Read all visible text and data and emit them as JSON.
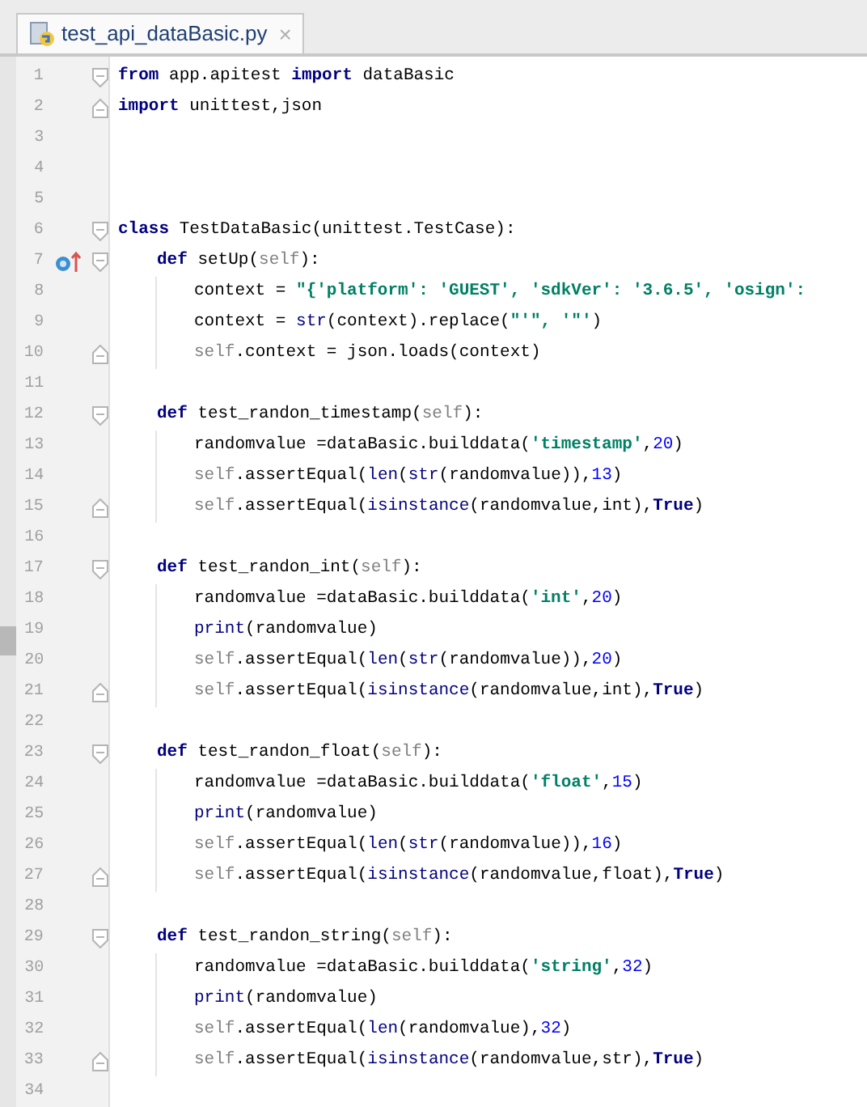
{
  "tab": {
    "title": "test_api_dataBasic.py",
    "close": "×"
  },
  "lines": [
    {
      "number": "1",
      "kind": "fold-start",
      "overridden": false,
      "tokens": [
        {
          "kind": "keyword",
          "text": "from"
        },
        {
          "kind": "plain",
          "text": " app.apitest "
        },
        {
          "kind": "keyword",
          "text": "import"
        },
        {
          "kind": "plain",
          "text": " dataBasic"
        }
      ]
    },
    {
      "number": "2",
      "kind": "fold-end",
      "overridden": false,
      "tokens": [
        {
          "kind": "keyword",
          "text": "import"
        },
        {
          "kind": "plain",
          "text": " unittest,json"
        }
      ]
    },
    {
      "number": "3",
      "kind": "line",
      "overridden": false
    },
    {
      "number": "4",
      "kind": "line",
      "overridden": false
    },
    {
      "number": "5",
      "kind": "line",
      "overridden": false
    },
    {
      "number": "6",
      "kind": "fold-start",
      "overridden": false,
      "tokens": [
        {
          "kind": "keyword",
          "text": "class"
        },
        {
          "kind": "plain",
          "text": " TestDataBasic(unittest.TestCase):"
        }
      ],
      "children": [
        {
          "number": "7",
          "kind": "fold-start",
          "overridden": true,
          "tokens": [
            {
              "kind": "keyword",
              "text": "def"
            },
            {
              "kind": "plain",
              "text": " setUp("
            },
            {
              "kind": "self",
              "text": "self"
            },
            {
              "kind": "plain",
              "text": "):"
            }
          ],
          "children": [
            {
              "number": "8",
              "kind": "line",
              "overridden": false,
              "tokens": [
                {
                  "kind": "plain",
                  "text": "context = "
                },
                {
                  "kind": "string",
                  "text": "\"{'platform': 'GUEST', 'sdkVer': '3.6.5', 'osign':"
                }
              ]
            },
            {
              "number": "9",
              "kind": "line",
              "overridden": false,
              "tokens": [
                {
                  "kind": "plain",
                  "text": "context = "
                },
                {
                  "kind": "builtin",
                  "text": "str"
                },
                {
                  "kind": "plain",
                  "text": "(context).replace("
                },
                {
                  "kind": "string",
                  "text": "\"'\", '\"'"
                },
                {
                  "kind": "plain",
                  "text": ")"
                }
              ]
            },
            {
              "number": "10",
              "kind": "fold-end",
              "overridden": false,
              "tokens": [
                {
                  "kind": "self",
                  "text": "self"
                },
                {
                  "kind": "plain",
                  "text": ".context = json.loads(context)"
                }
              ]
            }
          ]
        },
        {
          "number": "11",
          "kind": "line",
          "overridden": false
        },
        {
          "number": "12",
          "kind": "fold-start",
          "overridden": false,
          "tokens": [
            {
              "kind": "keyword",
              "text": "def"
            },
            {
              "kind": "plain",
              "text": " test_randon_timestamp("
            },
            {
              "kind": "self",
              "text": "self"
            },
            {
              "kind": "plain",
              "text": "):"
            }
          ],
          "children": [
            {
              "number": "13",
              "kind": "line",
              "overridden": false,
              "tokens": [
                {
                  "kind": "plain",
                  "text": "randomvalue =dataBasic.builddata("
                },
                {
                  "kind": "string",
                  "text": "'timestamp'"
                },
                {
                  "kind": "plain",
                  "text": ","
                },
                {
                  "kind": "number",
                  "text": "20"
                },
                {
                  "kind": "plain",
                  "text": ")"
                }
              ]
            },
            {
              "number": "14",
              "kind": "line",
              "overridden": false,
              "tokens": [
                {
                  "kind": "self",
                  "text": "self"
                },
                {
                  "kind": "plain",
                  "text": ".assertEqual("
                },
                {
                  "kind": "builtin",
                  "text": "len"
                },
                {
                  "kind": "plain",
                  "text": "("
                },
                {
                  "kind": "builtin",
                  "text": "str"
                },
                {
                  "kind": "plain",
                  "text": "(randomvalue)),"
                },
                {
                  "kind": "number",
                  "text": "13"
                },
                {
                  "kind": "plain",
                  "text": ")"
                }
              ]
            },
            {
              "number": "15",
              "kind": "fold-end",
              "overridden": false,
              "tokens": [
                {
                  "kind": "self",
                  "text": "self"
                },
                {
                  "kind": "plain",
                  "text": ".assertEqual("
                },
                {
                  "kind": "builtin",
                  "text": "isinstance"
                },
                {
                  "kind": "plain",
                  "text": "(randomvalue,int),"
                },
                {
                  "kind": "keyword",
                  "text": "True"
                },
                {
                  "kind": "plain",
                  "text": ")"
                }
              ]
            }
          ]
        },
        {
          "number": "16",
          "kind": "line",
          "overridden": false
        },
        {
          "number": "17",
          "kind": "fold-start",
          "overridden": false,
          "tokens": [
            {
              "kind": "keyword",
              "text": "def"
            },
            {
              "kind": "plain",
              "text": " test_randon_int("
            },
            {
              "kind": "self",
              "text": "self"
            },
            {
              "kind": "plain",
              "text": "):"
            }
          ],
          "children": [
            {
              "number": "18",
              "kind": "line",
              "overridden": false,
              "tokens": [
                {
                  "kind": "plain",
                  "text": "randomvalue =dataBasic.builddata("
                },
                {
                  "kind": "string",
                  "text": "'int'"
                },
                {
                  "kind": "plain",
                  "text": ","
                },
                {
                  "kind": "number",
                  "text": "20"
                },
                {
                  "kind": "plain",
                  "text": ")"
                }
              ]
            },
            {
              "number": "19",
              "kind": "line",
              "overridden": false,
              "tokens": [
                {
                  "kind": "builtin",
                  "text": "print"
                },
                {
                  "kind": "plain",
                  "text": "(randomvalue)"
                }
              ]
            },
            {
              "number": "20",
              "kind": "line",
              "overridden": false,
              "tokens": [
                {
                  "kind": "self",
                  "text": "self"
                },
                {
                  "kind": "plain",
                  "text": ".assertEqual("
                },
                {
                  "kind": "builtin",
                  "text": "len"
                },
                {
                  "kind": "plain",
                  "text": "("
                },
                {
                  "kind": "builtin",
                  "text": "str"
                },
                {
                  "kind": "plain",
                  "text": "(randomvalue)),"
                },
                {
                  "kind": "number",
                  "text": "20"
                },
                {
                  "kind": "plain",
                  "text": ")"
                }
              ]
            },
            {
              "number": "21",
              "kind": "fold-end",
              "overridden": false,
              "tokens": [
                {
                  "kind": "self",
                  "text": "self"
                },
                {
                  "kind": "plain",
                  "text": ".assertEqual("
                },
                {
                  "kind": "builtin",
                  "text": "isinstance"
                },
                {
                  "kind": "plain",
                  "text": "(randomvalue,int),"
                },
                {
                  "kind": "keyword",
                  "text": "True"
                },
                {
                  "kind": "plain",
                  "text": ")"
                }
              ]
            }
          ]
        },
        {
          "number": "22",
          "kind": "line",
          "overridden": false
        },
        {
          "number": "23",
          "kind": "fold-start",
          "overridden": false,
          "tokens": [
            {
              "kind": "keyword",
              "text": "def"
            },
            {
              "kind": "plain",
              "text": " test_randon_float("
            },
            {
              "kind": "self",
              "text": "self"
            },
            {
              "kind": "plain",
              "text": "):"
            }
          ],
          "children": [
            {
              "number": "24",
              "kind": "line",
              "overridden": false,
              "tokens": [
                {
                  "kind": "plain",
                  "text": "randomvalue =dataBasic.builddata("
                },
                {
                  "kind": "string",
                  "text": "'float'"
                },
                {
                  "kind": "plain",
                  "text": ","
                },
                {
                  "kind": "number",
                  "text": "15"
                },
                {
                  "kind": "plain",
                  "text": ")"
                }
              ]
            },
            {
              "number": "25",
              "kind": "line",
              "overridden": false,
              "tokens": [
                {
                  "kind": "builtin",
                  "text": "print"
                },
                {
                  "kind": "plain",
                  "text": "(randomvalue)"
                }
              ]
            },
            {
              "number": "26",
              "kind": "line",
              "overridden": false,
              "tokens": [
                {
                  "kind": "self",
                  "text": "self"
                },
                {
                  "kind": "plain",
                  "text": ".assertEqual("
                },
                {
                  "kind": "builtin",
                  "text": "len"
                },
                {
                  "kind": "plain",
                  "text": "("
                },
                {
                  "kind": "builtin",
                  "text": "str"
                },
                {
                  "kind": "plain",
                  "text": "(randomvalue)),"
                },
                {
                  "kind": "number",
                  "text": "16"
                },
                {
                  "kind": "plain",
                  "text": ")"
                }
              ]
            },
            {
              "number": "27",
              "kind": "fold-end",
              "overridden": false,
              "tokens": [
                {
                  "kind": "self",
                  "text": "self"
                },
                {
                  "kind": "plain",
                  "text": ".assertEqual("
                },
                {
                  "kind": "builtin",
                  "text": "isinstance"
                },
                {
                  "kind": "plain",
                  "text": "(randomvalue,float),"
                },
                {
                  "kind": "keyword",
                  "text": "True"
                },
                {
                  "kind": "plain",
                  "text": ")"
                }
              ]
            }
          ]
        },
        {
          "number": "28",
          "kind": "line",
          "overridden": false
        },
        {
          "number": "29",
          "kind": "fold-start",
          "overridden": false,
          "tokens": [
            {
              "kind": "keyword",
              "text": "def"
            },
            {
              "kind": "plain",
              "text": " test_randon_string("
            },
            {
              "kind": "self",
              "text": "self"
            },
            {
              "kind": "plain",
              "text": "):"
            }
          ],
          "children": [
            {
              "number": "30",
              "kind": "line",
              "overridden": false,
              "tokens": [
                {
                  "kind": "plain",
                  "text": "randomvalue =dataBasic.builddata("
                },
                {
                  "kind": "string",
                  "text": "'string'"
                },
                {
                  "kind": "plain",
                  "text": ","
                },
                {
                  "kind": "number",
                  "text": "32"
                },
                {
                  "kind": "plain",
                  "text": ")"
                }
              ]
            },
            {
              "number": "31",
              "kind": "line",
              "overridden": false,
              "tokens": [
                {
                  "kind": "builtin",
                  "text": "print"
                },
                {
                  "kind": "plain",
                  "text": "(randomvalue)"
                }
              ]
            },
            {
              "number": "32",
              "kind": "line",
              "overridden": false,
              "tokens": [
                {
                  "kind": "self",
                  "text": "self"
                },
                {
                  "kind": "plain",
                  "text": ".assertEqual("
                },
                {
                  "kind": "builtin",
                  "text": "len"
                },
                {
                  "kind": "plain",
                  "text": "(randomvalue),"
                },
                {
                  "kind": "number",
                  "text": "32"
                },
                {
                  "kind": "plain",
                  "text": ")"
                }
              ]
            },
            {
              "number": "33",
              "kind": "fold-end",
              "overridden": false,
              "tokens": [
                {
                  "kind": "self",
                  "text": "self"
                },
                {
                  "kind": "plain",
                  "text": ".assertEqual("
                },
                {
                  "kind": "builtin",
                  "text": "isinstance"
                },
                {
                  "kind": "plain",
                  "text": "(randomvalue,str),"
                },
                {
                  "kind": "keyword",
                  "text": "True"
                },
                {
                  "kind": "plain",
                  "text": ")"
                }
              ]
            }
          ]
        },
        {
          "number": "34",
          "kind": "line",
          "overridden": false
        }
      ]
    }
  ]
}
